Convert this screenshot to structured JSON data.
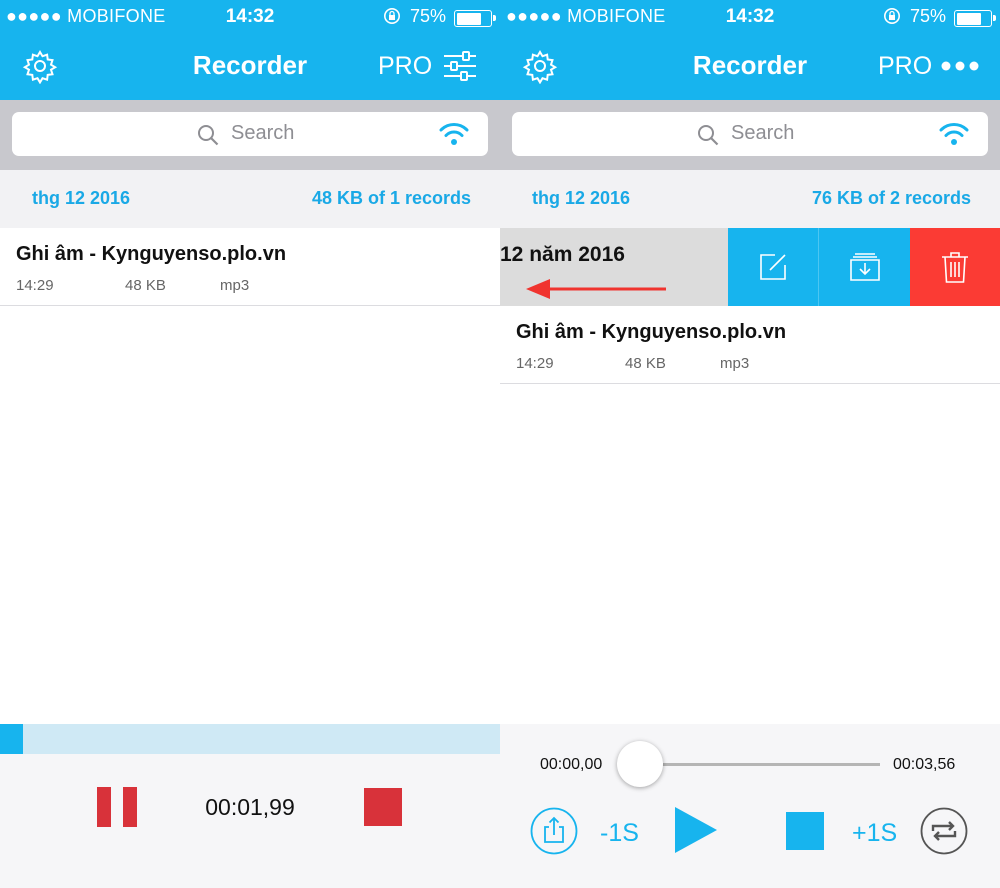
{
  "status_bar": {
    "carrier": "●●●●● MOBIFONE",
    "time": "14:32",
    "battery_percent": "75%",
    "battery_level": 0.75
  },
  "header": {
    "title": "Recorder",
    "pro_label": "PRO"
  },
  "search": {
    "placeholder": "Search"
  },
  "left": {
    "section": {
      "date": "thg 12 2016",
      "summary": "48 KB of 1 records"
    },
    "recordings": [
      {
        "name": "Ghi âm - Kynguyenso.plo.vn",
        "time": "14:29",
        "size": "48 KB",
        "format": "mp3"
      }
    ],
    "recording_progress": 0.045,
    "recording_time": "00:01,99"
  },
  "right": {
    "section": {
      "date": "thg 12 2016",
      "summary": "76 KB of 2 records"
    },
    "swiped_row_text": "12 năm 2016",
    "recordings": [
      {
        "name": "Ghi âm - Kynguyenso.plo.vn",
        "time": "14:29",
        "size": "48 KB",
        "format": "mp3"
      }
    ],
    "player": {
      "current_time": "00:00,00",
      "total_time": "00:03,56",
      "position": 0.0,
      "back_label": "-1S",
      "forward_label": "+1S"
    }
  },
  "colors": {
    "accent": "#17b4ee",
    "record_red": "#d8323a",
    "delete_red": "#fb3b34"
  }
}
